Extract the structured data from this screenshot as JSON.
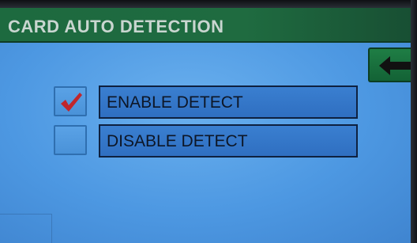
{
  "title": "CARD AUTO DETECTION",
  "back_button": {
    "icon": "back-arrow-icon"
  },
  "options": [
    {
      "label": "ENABLE DETECT",
      "checked": true
    },
    {
      "label": "DISABLE DETECT",
      "checked": false
    }
  ],
  "colors": {
    "screen": "#4d98e2",
    "title_bar": "#1d6a3f",
    "option_button": "#3a7fd0",
    "checkmark": "#c0262c",
    "back_button": "#1f7e45"
  }
}
